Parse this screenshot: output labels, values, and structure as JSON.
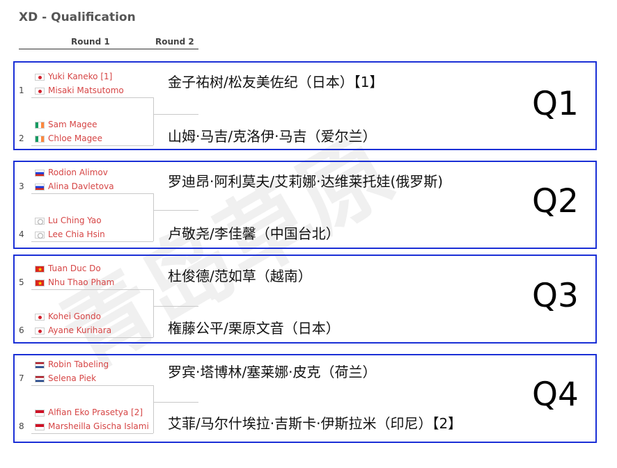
{
  "title": "XD - Qualification",
  "rounds": [
    "Round 1",
    "Round 2"
  ],
  "watermark": "青岛草原",
  "colors": {
    "box_border": "#1a2fd6",
    "player_text": "#d64545"
  },
  "matches": [
    {
      "q_label": "Q1",
      "cn_top": "金子祐树/松友美佐纪（日本）【1】",
      "cn_bottom": "山姆·马吉/克洛伊·马吉（爱尔兰）",
      "pairs": [
        {
          "seed": "1",
          "flag": "jp",
          "players": [
            "Yuki Kaneko [1]",
            "Misaki Matsutomo"
          ]
        },
        {
          "seed": "2",
          "flag": "ie",
          "players": [
            "Sam Magee",
            "Chloe Magee"
          ]
        }
      ]
    },
    {
      "q_label": "Q2",
      "cn_top": "罗迪昂·阿利莫夫/艾莉娜·达维莱托娃(俄罗斯)",
      "cn_bottom": "卢敬尧/李佳馨（中国台北）",
      "pairs": [
        {
          "seed": "3",
          "flag": "ru",
          "players": [
            "Rodion Alimov",
            "Alina Davletova"
          ]
        },
        {
          "seed": "4",
          "flag": "tw",
          "players": [
            "Lu Ching Yao",
            "Lee Chia Hsin"
          ]
        }
      ]
    },
    {
      "q_label": "Q3",
      "cn_top": "杜俊德/范如草（越南）",
      "cn_bottom": "権藤公平/栗原文音（日本）",
      "pairs": [
        {
          "seed": "5",
          "flag": "vn",
          "players": [
            "Tuan Duc Do",
            "Nhu Thao Pham"
          ]
        },
        {
          "seed": "6",
          "flag": "jp",
          "players": [
            "Kohei Gondo",
            "Ayane Kurihara"
          ]
        }
      ]
    },
    {
      "q_label": "Q4",
      "cn_top": "罗宾·塔博林/塞莱娜·皮克（荷兰）",
      "cn_bottom": "艾菲/马尔什埃拉·吉斯卡·伊斯拉米（印尼）【2】",
      "pairs": [
        {
          "seed": "7",
          "flag": "nl",
          "players": [
            "Robin Tabeling",
            "Selena Piek"
          ]
        },
        {
          "seed": "8",
          "flag": "id",
          "players": [
            "Alfian Eko Prasetya [2]",
            "Marsheilla Gischa Islami"
          ]
        }
      ]
    }
  ]
}
